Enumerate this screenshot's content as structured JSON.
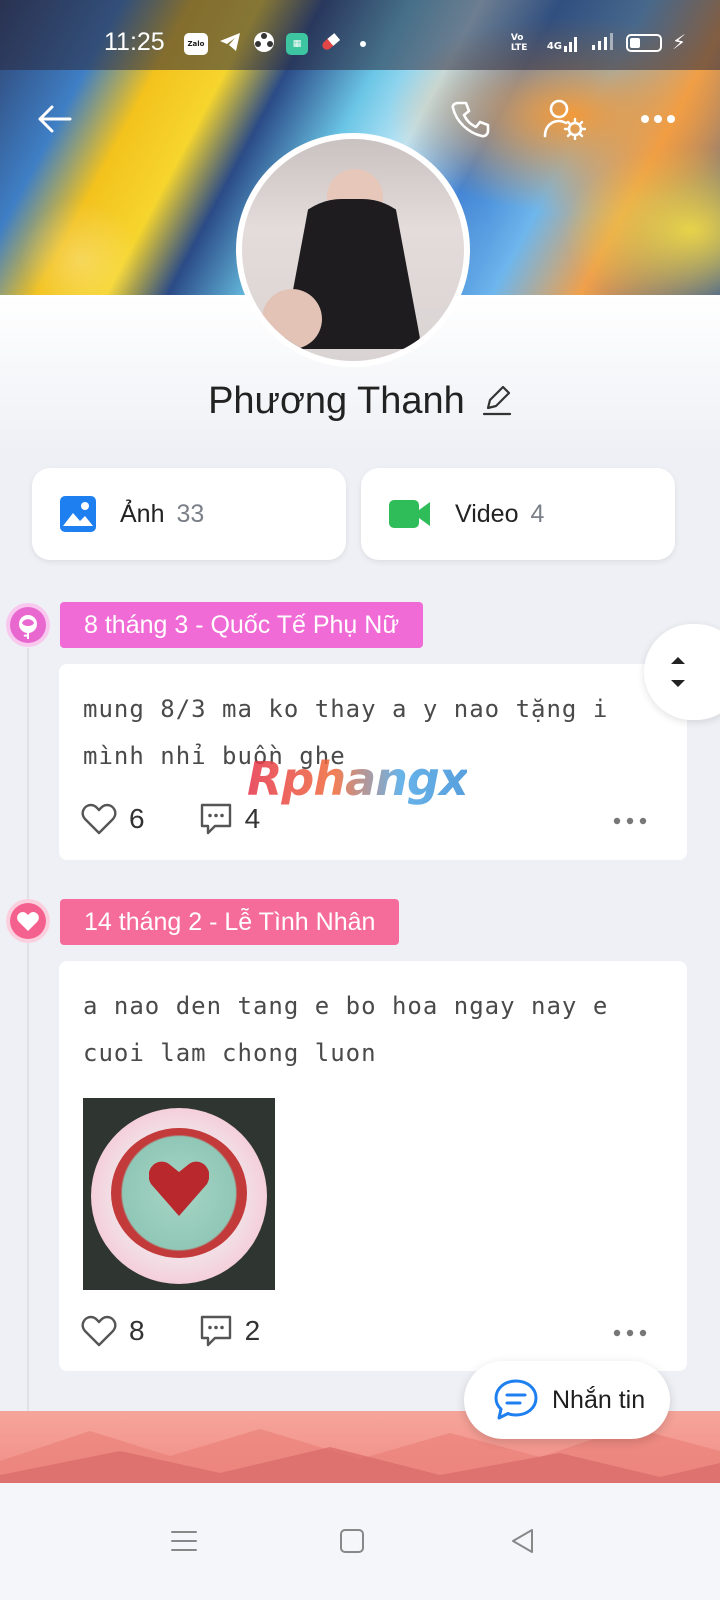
{
  "status_bar": {
    "time": "11:25",
    "zalo_label": "Zalo",
    "volte_label": "Vo LTE",
    "network_label": "4G"
  },
  "profile": {
    "name": "Phương Thanh"
  },
  "media": {
    "photos": {
      "label": "Ảnh",
      "count": "33"
    },
    "videos": {
      "label": "Video",
      "count": "4"
    }
  },
  "posts": [
    {
      "tag": "8 tháng 3 - Quốc Tế Phụ Nữ",
      "tag_color": "#f06bd6",
      "text": "mung 8/3 ma ko thay a y nao tặng i mình nhỉ buồn ghe",
      "likes": "6",
      "comments": "4"
    },
    {
      "tag": "14 tháng 2 - Lễ Tình Nhân",
      "tag_color": "#f56b9a",
      "text": "a nao den tang e bo hoa ngay nay e cuoi lam chong luon",
      "likes": "8",
      "comments": "2"
    }
  ],
  "watermark": "Rphangx",
  "message_button": {
    "label": "Nhắn tin"
  },
  "colors": {
    "accent_blue": "#1e7ff0",
    "video_green": "#2ebd59",
    "icon_grey": "#6a6f78"
  }
}
